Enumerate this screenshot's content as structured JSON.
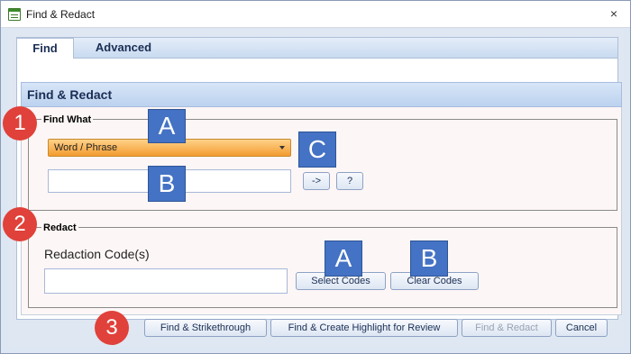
{
  "window": {
    "title": "Find & Redact",
    "close_glyph": "×"
  },
  "tabs": [
    {
      "label": "Find",
      "active": true
    },
    {
      "label": "Advanced",
      "active": false
    }
  ],
  "section": {
    "title": "Find & Redact"
  },
  "find_what": {
    "legend": "Find What",
    "dropdown_value": "Word / Phrase",
    "input_value": "",
    "arrow_button": "->",
    "help_button": "?"
  },
  "redact": {
    "legend": "Redact",
    "codes_label": "Redaction Code(s)",
    "codes_value": "",
    "select_codes_button": "Select Codes",
    "clear_codes_button": "Clear Codes"
  },
  "footer": {
    "strikethrough_button": "Find & Strikethrough",
    "highlight_button": "Find & Create Highlight for Review",
    "redact_button": "Find & Redact",
    "redact_button_enabled": false,
    "cancel_button": "Cancel"
  },
  "callouts": {
    "a1": "A",
    "b1": "B",
    "c": "C",
    "a2": "A",
    "b2": "B",
    "n1": "1",
    "n2": "2",
    "n3": "3"
  },
  "icons": {
    "title_icon": "form-icon",
    "dropdown_arrow": "chevron-down-icon"
  },
  "colors": {
    "accent_blue": "#4472c4",
    "callout_red": "#e0413a",
    "dropdown_orange": "#f39b2f"
  }
}
